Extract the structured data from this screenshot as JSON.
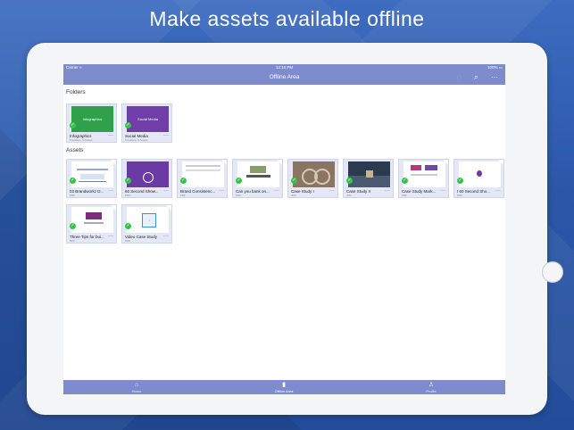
{
  "headline": "Make assets available offline",
  "status": {
    "carrier": "Carrier ≈",
    "time": "12:16 PM",
    "battery": "100%"
  },
  "nav": {
    "title": "Offline Area",
    "icons": [
      "refresh-icon",
      "search-icon",
      "more-icon"
    ]
  },
  "folders_heading": "Folders",
  "assets_heading": "Assets",
  "folders": [
    {
      "name": "Infographics",
      "meta": "5 Folders, 6 Assets",
      "thumb_text": "Infographics",
      "thumb_color": "#2fa14b"
    },
    {
      "name": "Social Media",
      "meta": "5 Folders, 6 Assets",
      "thumb_text": "Social Media",
      "thumb_color": "#6f3ea6"
    }
  ],
  "assets": [
    {
      "name": "03 Brandworkz D...",
      "meta": "PDF"
    },
    {
      "name": "60 Second Show...",
      "meta": "PNG"
    },
    {
      "name": "Brand Consistenc...",
      "meta": "PDF"
    },
    {
      "name": "Can you bank on...",
      "meta": "PDF"
    },
    {
      "name": "Case Study I",
      "meta": "JPG"
    },
    {
      "name": "Case Study II",
      "meta": "JPG"
    },
    {
      "name": "Case Study Mark...",
      "meta": "PDF"
    },
    {
      "name": "I 60 Second Sho...",
      "meta": "PDF"
    },
    {
      "name": "Three Tips for bui...",
      "meta": "PDF"
    },
    {
      "name": "Video Case Study",
      "meta": "M4V"
    }
  ],
  "tabs": [
    {
      "label": "Home",
      "icon": "home-icon"
    },
    {
      "label": "Offline Area",
      "icon": "offline-icon"
    },
    {
      "label": "Profile",
      "icon": "profile-icon"
    }
  ],
  "colors": {
    "bar": "#7e8ccd",
    "card": "#e4e8f6",
    "badge": "#37c34a"
  }
}
